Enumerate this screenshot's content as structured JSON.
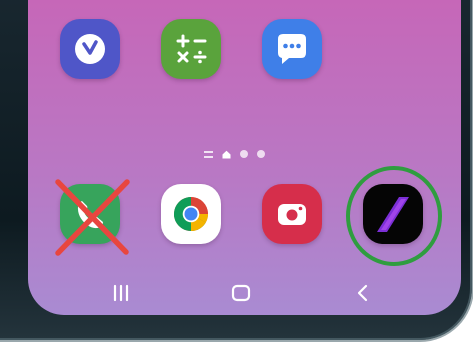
{
  "screen": {
    "wallpaper_colors": [
      "#c667b8",
      "#a98bd2"
    ]
  },
  "home_row": [
    {
      "app": "clock",
      "icon": "clock-icon",
      "color": "#4f56c8"
    },
    {
      "app": "calculator",
      "icon": "calculator-icon",
      "color": "#5aa33c"
    },
    {
      "app": "messages",
      "icon": "chat-bubble-icon",
      "color": "#3f7fe8"
    }
  ],
  "page_indicator": {
    "pages": 3,
    "current_page": 1,
    "has_feed_page": true
  },
  "dock": [
    {
      "app": "phone",
      "icon": "phone-icon",
      "color": "#37a45c",
      "annotation": "red-x"
    },
    {
      "app": "chrome",
      "icon": "chrome-icon",
      "color": "#ffffff"
    },
    {
      "app": "camera",
      "icon": "camera-icon",
      "color": "#d62e4b"
    },
    {
      "app": "slash-app",
      "icon": "purple-slash-icon",
      "color": "#050505",
      "annotation": "green-circle"
    }
  ],
  "annotations": {
    "cross_color": "#e8463f",
    "circle_color": "#2f9d3f"
  },
  "navigation_bar": {
    "recents": "recents-icon",
    "home": "home-icon",
    "back": "back-icon"
  }
}
